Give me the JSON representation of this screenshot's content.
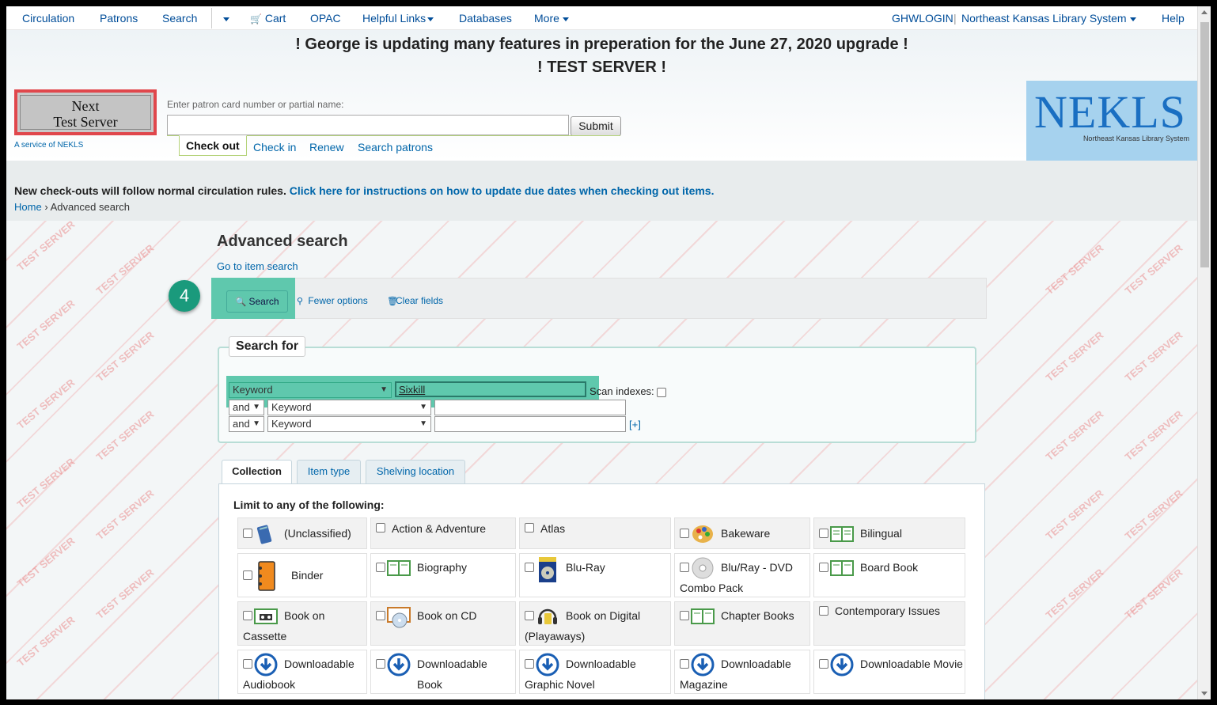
{
  "nav": {
    "items": [
      "Circulation",
      "Patrons",
      "Search",
      "Cart",
      "OPAC",
      "Helpful Links",
      "Databases",
      "More"
    ],
    "user": "GHWLOGIN",
    "library": "Northeast Kansas Library System",
    "help": "Help"
  },
  "banner": {
    "line1": "! George is updating many features in preperation for the June 27, 2020 upgrade !",
    "line2": "! TEST SERVER !"
  },
  "logo": {
    "line1": "Next",
    "line2": "Test Server",
    "service": "A service of NEKLS"
  },
  "patron": {
    "label": "Enter patron card number or partial name:",
    "value": "",
    "submit": "Submit"
  },
  "circ_tabs": [
    "Check out",
    "Check in",
    "Renew",
    "Search patrons"
  ],
  "nekls": {
    "big": "NEKLS",
    "small": "Northeast Kansas Library System"
  },
  "notice": {
    "text": "New check-outs will follow normal circulation rules.",
    "link": "Click here for instructions on how to update due dates when checking out items."
  },
  "breadcrumb": {
    "home": "Home",
    "sep": "›",
    "current": "Advanced search"
  },
  "page": {
    "title": "Advanced search",
    "goto_item": "Go to item search",
    "step": "4",
    "search_button": "Search",
    "fewer_options": "Fewer options",
    "clear_fields": "Clear fields"
  },
  "search_for": {
    "legend": "Search for",
    "rows": [
      {
        "op": "",
        "index": "Keyword",
        "value": "Sixkill"
      },
      {
        "op": "and",
        "index": "Keyword",
        "value": ""
      },
      {
        "op": "and",
        "index": "Keyword",
        "value": ""
      }
    ],
    "scan_label": "Scan indexes:",
    "plus": "[+]"
  },
  "tabs": [
    "Collection",
    "Item type",
    "Shelving location"
  ],
  "limit_title": "Limit to any of the following:",
  "collections": [
    [
      "(Unclassified)",
      "Action & Adventure",
      "Atlas",
      "Bakeware",
      "Bilingual"
    ],
    [
      "Binder",
      "Biography",
      "Blu-Ray",
      "Blu/Ray - DVD",
      "Board Book"
    ],
    [
      "Book on",
      "Book on CD",
      "Book on Digital",
      "Chapter Books",
      "Contemporary Issues"
    ],
    [
      "Downloadable",
      "Downloadable Book",
      "Downloadable",
      "Downloadable",
      "Downloadable Movie"
    ]
  ],
  "collection_second_lines": {
    "combo": "Combo Pack",
    "cassette": "Cassette",
    "playaways": "(Playaways)",
    "audiobook": "Audiobook",
    "graphic": "Graphic Novel",
    "magazine": "Magazine"
  },
  "watermark": "TEST SERVER",
  "colors": {
    "highlight": "#5fc8ad",
    "badge": "#1a9a7c",
    "link": "#0066aa",
    "nekls_bg": "#a6d2ee"
  }
}
